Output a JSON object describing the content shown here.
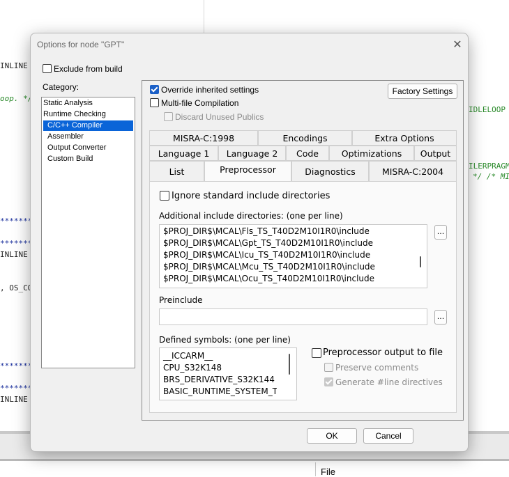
{
  "background": {
    "left_code": [
      "INLINE",
      "oop. */",
      "*******",
      "*******",
      "INLINE",
      ", OS_CO",
      "*******",
      "*******",
      "INLINE"
    ],
    "right_code": [
      "IDLELOOP",
      "ILERPRAGM",
      "*/ /* MI"
    ],
    "bottom_file_label": "File"
  },
  "dialog": {
    "title": "Options for node \"GPT\"",
    "close_glyph": "✕",
    "exclude_from_build": {
      "label": "Exclude from build",
      "checked": false
    },
    "category_label": "Category:",
    "categories": [
      {
        "label": "Static Analysis",
        "indent": false,
        "selected": false
      },
      {
        "label": "Runtime Checking",
        "indent": false,
        "selected": false
      },
      {
        "label": "C/C++ Compiler",
        "indent": true,
        "selected": true
      },
      {
        "label": "Assembler",
        "indent": true,
        "selected": false
      },
      {
        "label": "Output Converter",
        "indent": true,
        "selected": false
      },
      {
        "label": "Custom Build",
        "indent": true,
        "selected": false
      }
    ],
    "override_inherited": {
      "label": "Override inherited settings",
      "checked": true
    },
    "multi_file": {
      "label": "Multi-file Compilation",
      "checked": false
    },
    "discard_unused": {
      "label": "Discard Unused Publics",
      "checked": false,
      "disabled": true
    },
    "factory_settings_label": "Factory Settings",
    "tabs_row1": [
      "MISRA-C:1998",
      "Encodings",
      "Extra Options"
    ],
    "tabs_row2": [
      "Language 1",
      "Language 2",
      "Code",
      "Optimizations",
      "Output"
    ],
    "tabs_row3": [
      "List",
      "Preprocessor",
      "Diagnostics",
      "MISRA-C:2004"
    ],
    "active_tab": "Preprocessor",
    "preprocessor": {
      "ignore_std_label": "Ignore standard include directorieѕ",
      "ignore_std_checked": false,
      "additional_include_label": "Additional include directories: (one per line)",
      "include_dirs": [
        "$PROJ_DIR$\\MCAL\\Fls_TS_T40D2M10I1R0\\include",
        "$PROJ_DIR$\\MCAL\\Gpt_TS_T40D2M10I1R0\\include",
        "$PROJ_DIR$\\MCAL\\Icu_TS_T40D2M10I1R0\\include",
        "$PROJ_DIR$\\MCAL\\Mcu_TS_T40D2M10I1R0\\include",
        "$PROJ_DIR$\\MCAL\\Ocu_TS_T40D2M10I1R0\\include"
      ],
      "ellipsis": "...",
      "preinclude_label": "Preinclude",
      "preinclude_value": "",
      "defined_symbols_label": "Defined symbols: (one per line)",
      "defined_symbols": [
        "__ICCARM__",
        "CPU_S32K148",
        "BRS_DERIVATIVE_S32K144",
        "BASIC_RUNTIME_SYSTEM_TYI"
      ],
      "pp_output_label": "Preprocessor output to file",
      "pp_output_checked": false,
      "preserve_comments_label": "Preserve comments",
      "preserve_comments_checked": false,
      "generate_line_label": "Generate #line directives",
      "generate_line_checked": true
    },
    "ok_label": "OK",
    "cancel_label": "Cancel"
  }
}
